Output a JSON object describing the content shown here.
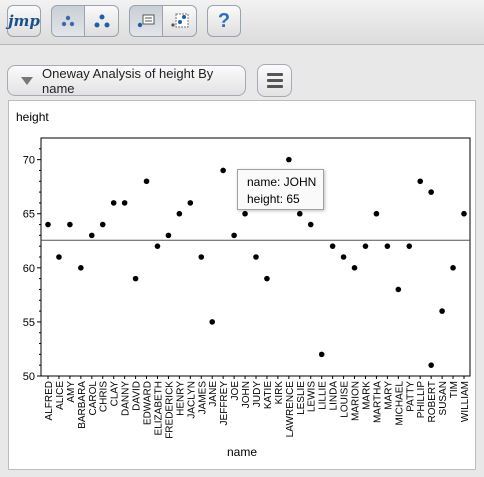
{
  "toolbar": {
    "logo_text": "jmp",
    "help_label": "?"
  },
  "report": {
    "title": "Oneway Analysis of height By name"
  },
  "tooltip": {
    "name_text": "name: JOHN",
    "height_text": "height: 65"
  },
  "chart_data": {
    "type": "scatter",
    "xlabel": "name",
    "ylabel": "height",
    "ylim": [
      50,
      72
    ],
    "yticks": [
      50,
      55,
      60,
      65,
      70
    ],
    "mean_line": 62.55,
    "grid": false,
    "categories": [
      "ALFRED",
      "ALICE",
      "AMY",
      "BARBARA",
      "CAROL",
      "CHRIS",
      "CLAY",
      "DANNY",
      "DAVID",
      "EDWARD",
      "ELIZABETH",
      "FREDERICK",
      "HENRY",
      "JACLYN",
      "JAMES",
      "JANE",
      "JEFFREY",
      "JOE",
      "JOHN",
      "JUDY",
      "KATIE",
      "KIRK",
      "LAWRENCE",
      "LESLIE",
      "LEWIS",
      "LILLIE",
      "LINDA",
      "LOUISE",
      "MARION",
      "MARK",
      "MARTHA",
      "MARY",
      "MICHAEL",
      "PATTY",
      "PHILLIP",
      "ROBERT",
      "SUSAN",
      "TIM",
      "WILLIAM"
    ],
    "points": [
      {
        "x": "ALFRED",
        "y": 64
      },
      {
        "x": "ALICE",
        "y": 61
      },
      {
        "x": "AMY",
        "y": 64
      },
      {
        "x": "BARBARA",
        "y": 60
      },
      {
        "x": "CAROL",
        "y": 63
      },
      {
        "x": "CHRIS",
        "y": 64
      },
      {
        "x": "CLAY",
        "y": 66
      },
      {
        "x": "DANNY",
        "y": 66
      },
      {
        "x": "DAVID",
        "y": 59
      },
      {
        "x": "EDWARD",
        "y": 68
      },
      {
        "x": "ELIZABETH",
        "y": 62
      },
      {
        "x": "FREDERICK",
        "y": 63
      },
      {
        "x": "HENRY",
        "y": 65
      },
      {
        "x": "JACLYN",
        "y": 66
      },
      {
        "x": "JAMES",
        "y": 61
      },
      {
        "x": "JANE",
        "y": 55
      },
      {
        "x": "JEFFREY",
        "y": 69
      },
      {
        "x": "JOE",
        "y": 63
      },
      {
        "x": "JOHN",
        "y": 65
      },
      {
        "x": "JUDY",
        "y": 61
      },
      {
        "x": "KATIE",
        "y": 59
      },
      {
        "x": "LAWRENCE",
        "y": 70
      },
      {
        "x": "LESLIE",
        "y": 65
      },
      {
        "x": "LEWIS",
        "y": 64
      },
      {
        "x": "LILLIE",
        "y": 52
      },
      {
        "x": "LINDA",
        "y": 62
      },
      {
        "x": "LOUISE",
        "y": 61
      },
      {
        "x": "MARION",
        "y": 60
      },
      {
        "x": "MARK",
        "y": 62
      },
      {
        "x": "MARTHA",
        "y": 65
      },
      {
        "x": "MARY",
        "y": 62
      },
      {
        "x": "MICHAEL",
        "y": 58
      },
      {
        "x": "PATTY",
        "y": 62
      },
      {
        "x": "PHILLIP",
        "y": 68
      },
      {
        "x": "ROBERT",
        "y": 67
      },
      {
        "x": "ROBERT",
        "y": 51
      },
      {
        "x": "SUSAN",
        "y": 56
      },
      {
        "x": "TIM",
        "y": 60
      },
      {
        "x": "WILLIAM",
        "y": 65
      }
    ]
  }
}
